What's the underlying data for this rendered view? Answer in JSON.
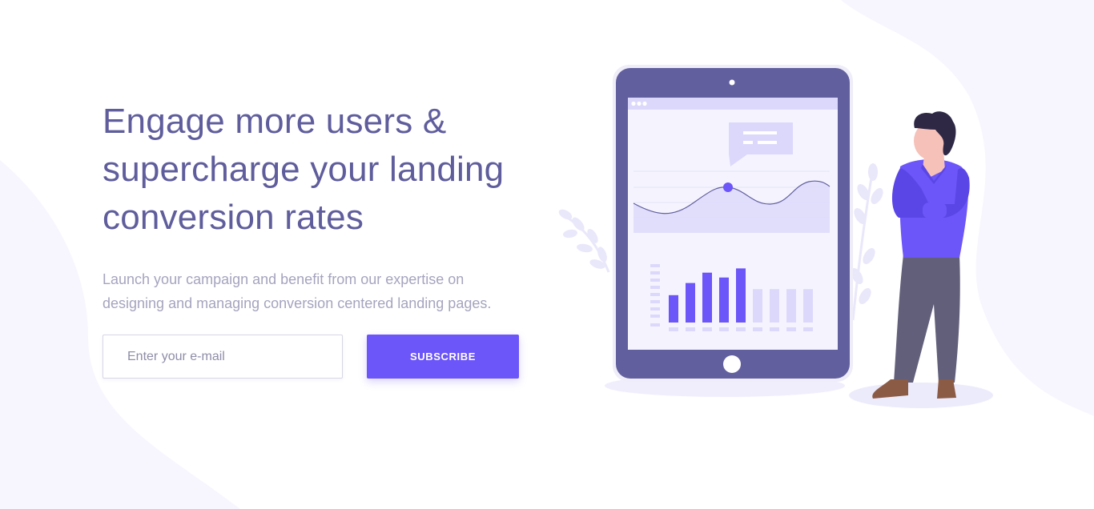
{
  "hero": {
    "headline_lines": [
      "Engage more users &",
      "supercharge your landing",
      "conversion rates"
    ],
    "subtext_lines": [
      "Launch your campaign and benefit from our expertise on",
      "designing and managing conversion centered landing pages."
    ]
  },
  "signup": {
    "email_placeholder": "Enter your e-mail",
    "subscribe_label": "SUBSCRIBE"
  },
  "illustration": {
    "bars": [
      {
        "value": 0.45,
        "active": true
      },
      {
        "value": 0.65,
        "active": true
      },
      {
        "value": 0.82,
        "active": true
      },
      {
        "value": 0.74,
        "active": true
      },
      {
        "value": 0.89,
        "active": true
      },
      {
        "value": 0.55,
        "active": false
      },
      {
        "value": 0.55,
        "active": false
      },
      {
        "value": 0.55,
        "active": false
      },
      {
        "value": 0.55,
        "active": false
      }
    ]
  },
  "colors": {
    "brand": "#6c55f9",
    "heading": "#5f5d9c",
    "body": "#a5a4bf",
    "tablet": "#625f9f"
  }
}
